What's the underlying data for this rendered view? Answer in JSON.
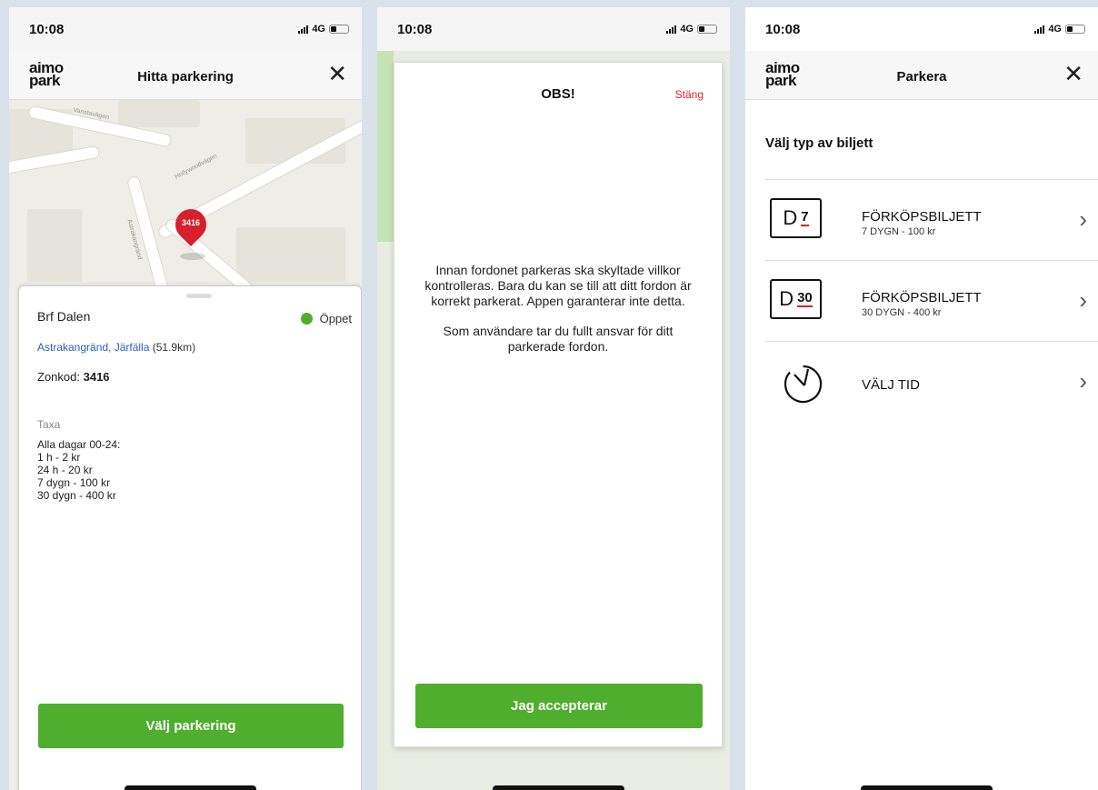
{
  "status_bar": {
    "time": "10:08",
    "network": "4G"
  },
  "screen1": {
    "logo_line1": "aimo",
    "logo_line2": "park",
    "title": "Hitta parkering",
    "close_icon": "close-icon",
    "map": {
      "pin_code": "3416",
      "roads": [
        "Vanstavägen",
        "Hollywoodvägen",
        "Astrakangränd"
      ]
    },
    "panel": {
      "name": "Brf Dalen",
      "status": "Öppet",
      "status_color": "#4fae2d",
      "address_link": "Astrakangränd, Järfälla",
      "distance": "(51.9km)",
      "zone_label": "Zonkod:",
      "zone_code": "3416",
      "taxa_label": "Taxa",
      "taxa_lines": [
        "Alla dagar 00-24:",
        "1 h - 2 kr",
        "24 h - 20 kr",
        "7 dygn - 100 kr",
        "30 dygn - 400 kr"
      ],
      "button": "Välj parkering"
    }
  },
  "screen2": {
    "title": "OBS!",
    "close_label": "Stäng",
    "paragraph1": "Innan fordonet parkeras ska skyltade villkor kontrolleras. Bara du kan se till att ditt fordon är korrekt parkerat. Appen garanterar inte detta.",
    "paragraph2": "Som användare tar du fullt ansvar för ditt parkerade fordon.",
    "button": "Jag accepterar"
  },
  "screen3": {
    "logo_line1": "aimo",
    "logo_line2": "park",
    "title": "Parkera",
    "section_label": "Välj typ av biljett",
    "tickets": [
      {
        "icon_letter": "D",
        "icon_num": "7",
        "title": "FÖRKÖPSBILJETT",
        "sub": "7 DYGN - 100 kr"
      },
      {
        "icon_letter": "D",
        "icon_num": "30",
        "title": "FÖRKÖPSBILJETT",
        "sub": "30 DYGN - 400 kr"
      }
    ],
    "choose_time": "VÄLJ TID"
  },
  "colors": {
    "accent_green": "#4fae2d",
    "accent_red": "#d81f2c",
    "link_blue": "#2b62c2"
  }
}
